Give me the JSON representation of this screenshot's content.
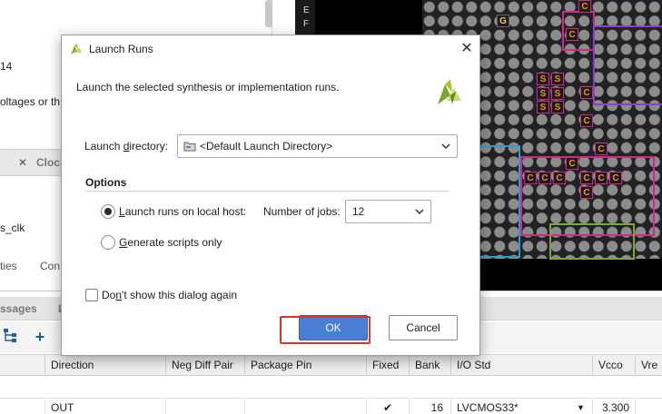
{
  "background": {
    "left_panel": {
      "line1": "14",
      "line2": "oltages or th",
      "tab_close": "✕",
      "tab_label": "Clock",
      "clock_item": "s_clk",
      "bottom_tab1": "ties",
      "bottom_tab2": "Con"
    },
    "dark_strip": {
      "letter1": "E",
      "letter2": "F"
    },
    "device_cells": {
      "g_label": "G",
      "s_label": "S",
      "c_label": "C"
    },
    "messages_tabs": {
      "tab1": "ssages",
      "tab2": "L"
    },
    "toolbar": {
      "add_label": "+"
    },
    "table": {
      "columns": [
        "Direction",
        "Neg Diff Pair",
        "Package Pin",
        "Fixed",
        "Bank",
        "I/O Std",
        "Vcco",
        "Vre"
      ],
      "row": {
        "direction": "OUT",
        "neg_diff_pair": "",
        "package_pin": "",
        "fixed": "✔",
        "bank": "16",
        "io_std": "LVCMOS33*",
        "io_std_arrow": "▼",
        "vcco": "3.300"
      }
    }
  },
  "dialog": {
    "title": "Launch Runs",
    "close": "✕",
    "description": "Launch the selected synthesis or implementation runs.",
    "launch_dir_label_a": "Launch ",
    "launch_dir_label_u": "d",
    "launch_dir_label_b": "irectory:",
    "launch_dir_value": "<Default Launch Directory>",
    "options_title": "Options",
    "opt1_a": "",
    "opt1_u": "L",
    "opt1_b": "aunch runs on local host:",
    "jobs_label_a": "Number of ",
    "jobs_label_u": "j",
    "jobs_label_b": "obs:",
    "jobs_value": "12",
    "opt2_a": "",
    "opt2_u": "G",
    "opt2_b": "enerate scripts only",
    "dont_show_a": "Do",
    "dont_show_u": "n",
    "dont_show_b": "'t show this dialog again",
    "ok_label": "OK",
    "cancel_label": "Cancel"
  },
  "colors": {
    "accent_button": "#4a7fd6",
    "highlight": "#e0322b",
    "xilinx_logo": "#a8c63a"
  }
}
